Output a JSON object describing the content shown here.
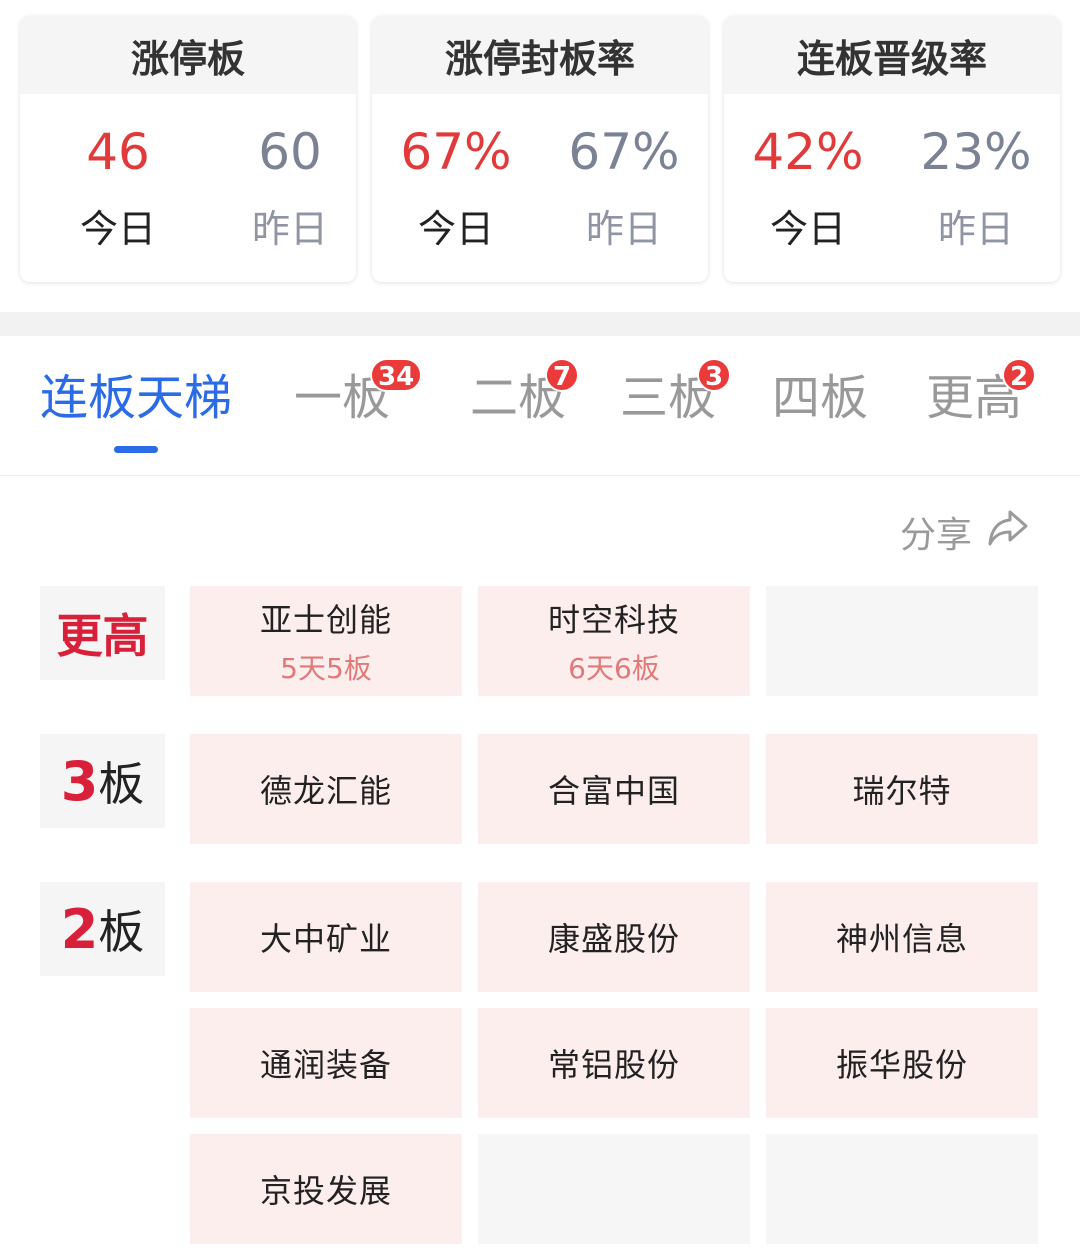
{
  "stats": [
    {
      "title": "涨停板",
      "today_value": "46",
      "yesterday_value": "60",
      "today_label": "今日",
      "yesterday_label": "昨日"
    },
    {
      "title": "涨停封板率",
      "today_value": "67%",
      "yesterday_value": "67%",
      "today_label": "今日",
      "yesterday_label": "昨日"
    },
    {
      "title": "连板晋级率",
      "today_value": "42%",
      "yesterday_value": "23%",
      "today_label": "今日",
      "yesterday_label": "昨日"
    }
  ],
  "tabs": [
    {
      "label": "连板天梯",
      "badge": ""
    },
    {
      "label": "一板",
      "badge": "34"
    },
    {
      "label": "二板",
      "badge": "7"
    },
    {
      "label": "三板",
      "badge": "3"
    },
    {
      "label": "四板",
      "badge": ""
    },
    {
      "label": "更高",
      "badge": "2"
    }
  ],
  "share": {
    "label": "分享",
    "icon": "share-arrow-icon"
  },
  "ladder": {
    "higher": {
      "label": "更高",
      "stocks": [
        {
          "name": "亚士创能",
          "detail": "5天5板"
        },
        {
          "name": "时空科技",
          "detail": "6天6板"
        }
      ]
    },
    "board3": {
      "num": "3",
      "unit": "板",
      "stocks": [
        {
          "name": "德龙汇能"
        },
        {
          "name": "合富中国"
        },
        {
          "name": "瑞尔特"
        }
      ]
    },
    "board2": {
      "num": "2",
      "unit": "板",
      "stocks": [
        {
          "name": "大中矿业"
        },
        {
          "name": "康盛股份"
        },
        {
          "name": "神州信息"
        },
        {
          "name": "通润装备"
        },
        {
          "name": "常铝股份"
        },
        {
          "name": "振华股份"
        },
        {
          "name": "京投发展"
        }
      ]
    }
  },
  "colors": {
    "accent": "#2b6be6",
    "up_red": "#e23a3a",
    "badge_red": "#ea3a3a",
    "cell_pink": "#fdeeee"
  }
}
